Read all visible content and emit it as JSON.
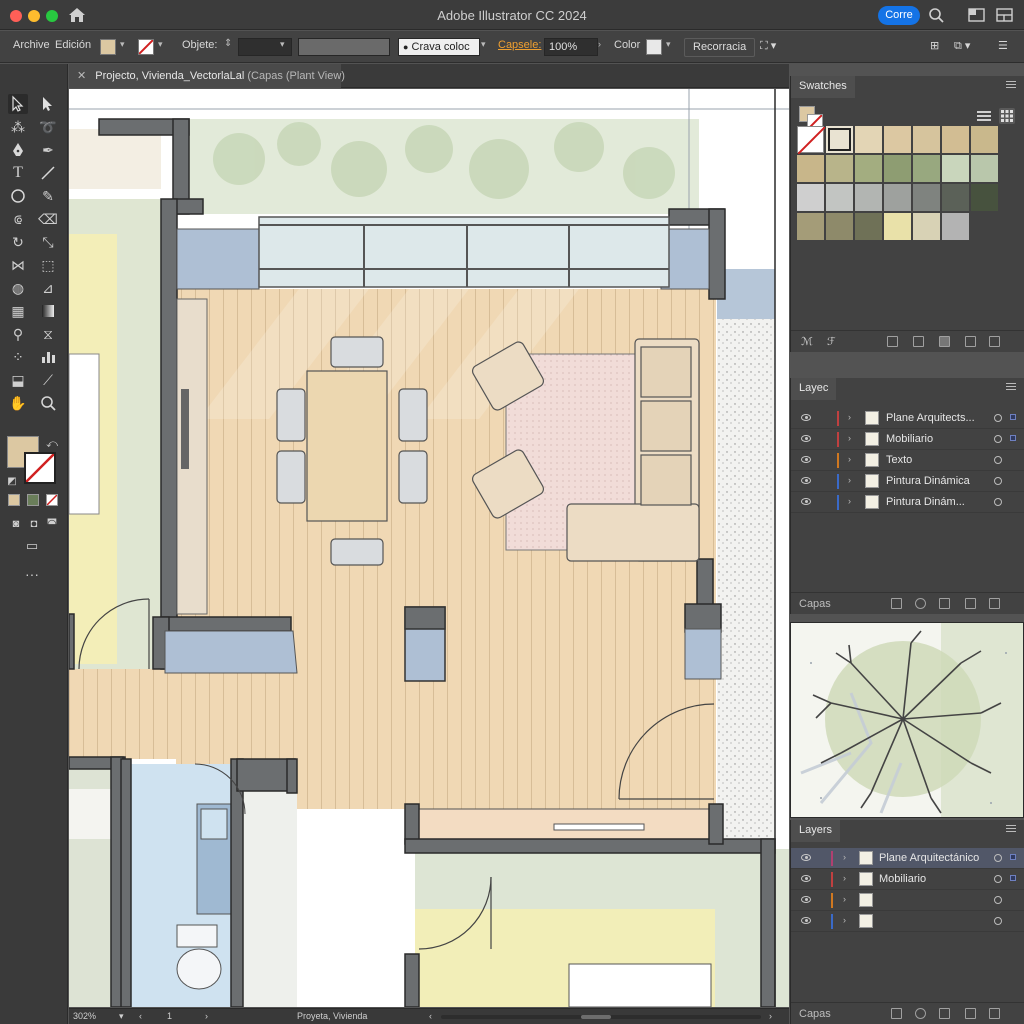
{
  "app": {
    "title": "Adobe Illustrator CC 2024",
    "share_label": "Corre"
  },
  "control_bar": {
    "archive_label": "Archive",
    "edit_label": "Edición",
    "object_label": "Objete:",
    "brush_label": "Crava coloc",
    "opacity_label": "Capsele:",
    "opacity_value": "100%",
    "color_label": "Color",
    "recolor_label": "Recorracia"
  },
  "document": {
    "tab_name": "Projecto, Vivienda_VectorlaLal",
    "tab_suffix": "(Capas (Plant View)"
  },
  "status_bar": {
    "zoom": "302%",
    "artboard": "1",
    "doc_name": "Proyeta, Vivienda"
  },
  "swatches_panel": {
    "title": "Swatches",
    "colors": [
      [
        "#ffffff",
        "#e9e3d2",
        "#e3d5b5",
        "#dcc8a2",
        "#d6c49d",
        "#d2bd93",
        "#c9b88c"
      ],
      [
        "#c8b68a",
        "#b8b48a",
        "#a3ad80",
        "#8e9d72",
        "#98a87f",
        "#c9d6bc",
        "#b9c7ab"
      ],
      [
        "#cfcfcf",
        "#c2c5c2",
        "#b2b5b2",
        "#9ea19e",
        "#7f837f",
        "#5b6158",
        "#47523e"
      ],
      [
        "#a49c78",
        "#8e8a6a",
        "#6f7157",
        "#e9e1a9",
        "#d8d2b5",
        "#b3b3b3"
      ]
    ]
  },
  "layers_panel_top": {
    "title": "Layec",
    "footer_label": "Capas",
    "layers": [
      {
        "name": "Plane Arquitects...",
        "color": "#c04040"
      },
      {
        "name": "Mobiliario",
        "color": "#c04040"
      },
      {
        "name": "Texto",
        "color": "#d07820"
      },
      {
        "name": "Pintura Dinámica",
        "color": "#3a6ac8"
      },
      {
        "name": "Pintura Dinám...",
        "color": "#3a6ac8"
      }
    ]
  },
  "layers_panel_bottom": {
    "title": "Layers",
    "footer_label": "Capas",
    "layers": [
      {
        "name": "Plane Arquitectánico",
        "color": "#b04070",
        "selected": true
      },
      {
        "name": "Mobiliario",
        "color": "#c04040"
      },
      {
        "name": "",
        "color": "#d07820"
      },
      {
        "name": "",
        "color": "#3a6ac8"
      }
    ]
  }
}
